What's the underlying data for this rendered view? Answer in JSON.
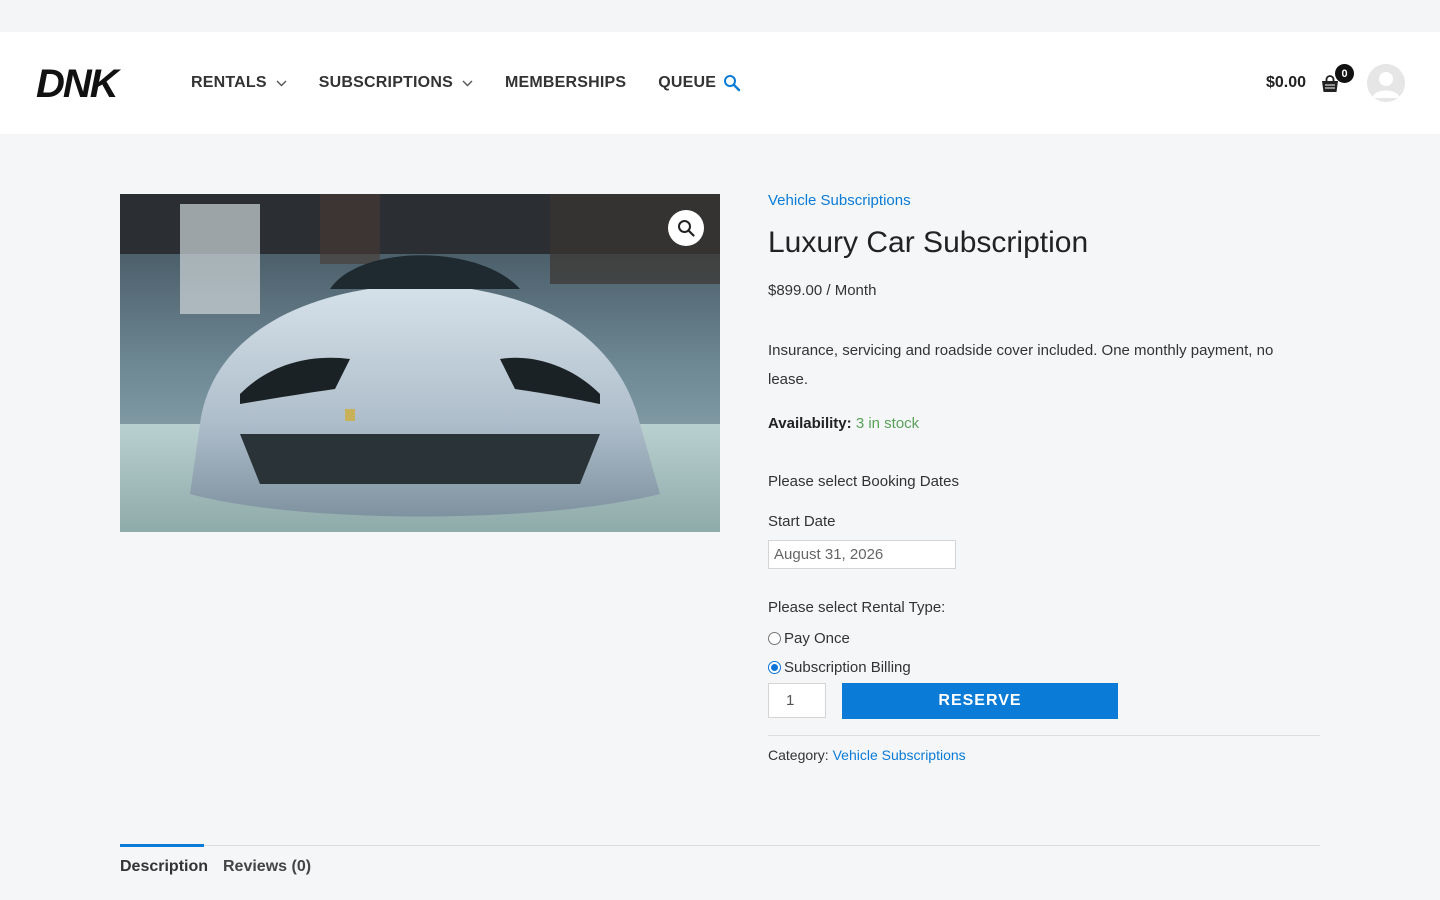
{
  "brand": {
    "logo_text": "DNK"
  },
  "nav": {
    "items": [
      {
        "label": "RENTALS",
        "has_dropdown": true
      },
      {
        "label": "SUBSCRIPTIONS",
        "has_dropdown": true
      },
      {
        "label": "MEMBERSHIPS",
        "has_dropdown": false
      },
      {
        "label": "QUEUE",
        "has_dropdown": false
      }
    ],
    "search_icon": "search-icon"
  },
  "cart": {
    "total": "$0.00",
    "count": "0",
    "icon": "shopping-bag-icon"
  },
  "account": {
    "icon": "avatar-icon"
  },
  "product": {
    "image_icon": "zoom-icon",
    "category_link": "Vehicle Subscriptions",
    "title": "Luxury Car Subscription",
    "price": "$899.00 / Month",
    "description": "Insurance, servicing and roadside cover included. One monthly payment, no lease.",
    "availability_label": "Availability:",
    "availability_value": "3 in stock",
    "booking_prompt": "Please select Booking Dates",
    "start_date_label": "Start Date",
    "start_date_value": "August 31, 2026",
    "rental_type_label": "Please select Rental Type:",
    "rental_options": [
      {
        "label": "Pay Once",
        "selected": false
      },
      {
        "label": "Subscription Billing",
        "selected": true
      }
    ],
    "quantity": "1",
    "reserve_label": "RESERVE",
    "category_label": "Category:",
    "category_value": "Vehicle Subscriptions"
  },
  "tabs": [
    {
      "label": "Description",
      "active": true
    },
    {
      "label": "Reviews (0)",
      "active": false
    }
  ],
  "colors": {
    "accent": "#0a7bd6",
    "stock": "#5aa15a",
    "page_bg": "#f4f6f8"
  }
}
